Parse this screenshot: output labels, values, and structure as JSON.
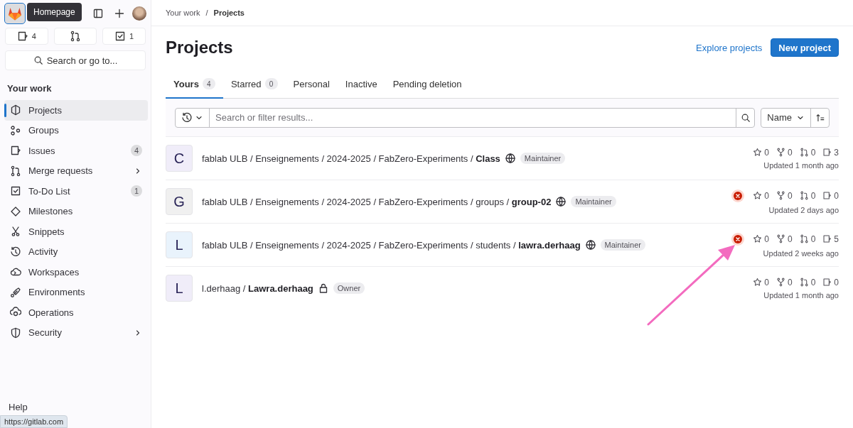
{
  "sidebar": {
    "tooltip": "Homepage",
    "counters": [
      {
        "kind": "issue",
        "count": "4"
      },
      {
        "kind": "merge"
      },
      {
        "kind": "todo",
        "count": "1"
      }
    ],
    "search": {
      "placeholder": "Search or go to..."
    },
    "section_title": "Your work",
    "items": [
      {
        "kind": "project",
        "label": "Projects",
        "selected": true
      },
      {
        "kind": "group",
        "label": "Groups",
        "selected": false
      },
      {
        "kind": "issue",
        "label": "Issues",
        "selected": false,
        "badge": "4"
      },
      {
        "kind": "merge",
        "label": "Merge requests",
        "selected": false,
        "expandable": true
      },
      {
        "kind": "todo",
        "label": "To-Do List",
        "selected": false,
        "badge": "1"
      },
      {
        "kind": "milestone",
        "label": "Milestones",
        "selected": false
      },
      {
        "kind": "snippet",
        "label": "Snippets",
        "selected": false
      },
      {
        "kind": "activity",
        "label": "Activity",
        "selected": false
      },
      {
        "kind": "workspace",
        "label": "Workspaces",
        "selected": false
      },
      {
        "kind": "environment",
        "label": "Environments",
        "selected": false
      },
      {
        "kind": "operation",
        "label": "Operations",
        "selected": false
      },
      {
        "kind": "security",
        "label": "Security",
        "selected": false,
        "expandable": true
      }
    ],
    "help": "Help"
  },
  "breadcrumbs": [
    "Your work",
    "Projects"
  ],
  "breadcrumb_separator": "/",
  "title": "Projects",
  "actions": {
    "link": "Explore projects",
    "button": "New project"
  },
  "tabs": [
    {
      "label": "Yours",
      "count": "4",
      "selected": true
    },
    {
      "label": "Starred",
      "count": "0",
      "selected": false
    },
    {
      "label": "Personal",
      "selected": false
    },
    {
      "label": "Inactive",
      "selected": false
    },
    {
      "label": "Pending deletion",
      "selected": false
    }
  ],
  "filter": {
    "placeholder": "Search or filter results...",
    "sort": "Name"
  },
  "projects": [
    {
      "letter": "C",
      "color": "#f0edf9",
      "path": "fablab ULB / Enseignements / 2024-2025 / FabZero-Experiments / ",
      "name": "Class",
      "kind": "public",
      "role": "Maintainer",
      "pipeline_failed": false,
      "stats": [
        "0",
        "0",
        "0",
        "3"
      ],
      "updated": "Updated 1 month ago"
    },
    {
      "letter": "G",
      "color": "#f0f0f0",
      "path": "fablab ULB / Enseignements / 2024-2025 / FabZero-Experiments / groups / ",
      "name": "group-02",
      "kind": "public",
      "role": "Maintainer",
      "pipeline_failed": true,
      "stats": [
        "0",
        "0",
        "0",
        "0"
      ],
      "updated": "Updated 2 days ago"
    },
    {
      "letter": "L",
      "color": "#e9f3fc",
      "path": "fablab ULB / Enseignements / 2024-2025 / FabZero-Experiments / students / ",
      "name": "lawra.derhaag",
      "kind": "public",
      "role": "Maintainer",
      "pipeline_failed": true,
      "stats": [
        "0",
        "0",
        "0",
        "5"
      ],
      "updated": "Updated 2 weeks ago"
    },
    {
      "letter": "L",
      "color": "#f0edf9",
      "path": "l.derhaag / ",
      "name": "Lawra.derhaag",
      "kind": "private",
      "role": "Owner",
      "pipeline_failed": false,
      "stats": [
        "0",
        "0",
        "0",
        "0"
      ],
      "updated": "Updated 1 month ago"
    }
  ],
  "status_url": "https://gitlab.com"
}
